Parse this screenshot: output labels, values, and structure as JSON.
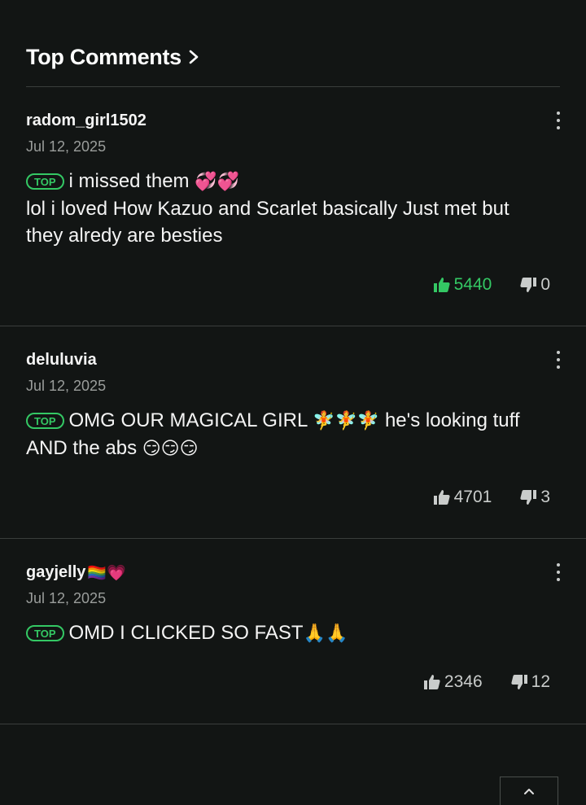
{
  "header": {
    "title": "Top Comments",
    "chevron_icon": "chevron-right-icon"
  },
  "badge_label": "TOP",
  "colors": {
    "background": "#121514",
    "accent_green": "#34c864",
    "separator": "#3a3e3c",
    "muted_text": "#9a9d9b"
  },
  "comments": [
    {
      "author": "radom_girl1502",
      "author_emoji": "",
      "date": "Jul 12, 2025",
      "text": "i missed them 💞💞 lol i loved How Kazuo and Scarlet basically Just met but they alredy are besties",
      "text_line1": "i missed them ",
      "emoji_line1": "💞💞",
      "text_rest": "lol i loved How Kazuo and Scarlet basically Just met but they alredy are besties",
      "likes": "5440",
      "dislikes": "0",
      "liked": true
    },
    {
      "author": "deluluvia",
      "author_emoji": "",
      "date": "Jul 12, 2025",
      "text_line1": "OMG OUR MAGICAL GIRL ",
      "emoji_line1": "🧚🧚🧚",
      "text_mid": " he's looking tuff AND the abs ",
      "emoji_end": "😏😏😏",
      "likes": "4701",
      "dislikes": "3",
      "liked": false
    },
    {
      "author": "gayjelly",
      "author_emoji": "🏳️‍🌈💗",
      "date": "Jul 12, 2025",
      "text_line1": "OMD I CLICKED SO FAST",
      "emoji_line1": "🙏🙏",
      "likes": "2346",
      "dislikes": "12",
      "liked": false
    }
  ],
  "scroll_top_icon": "chevron-up-icon"
}
